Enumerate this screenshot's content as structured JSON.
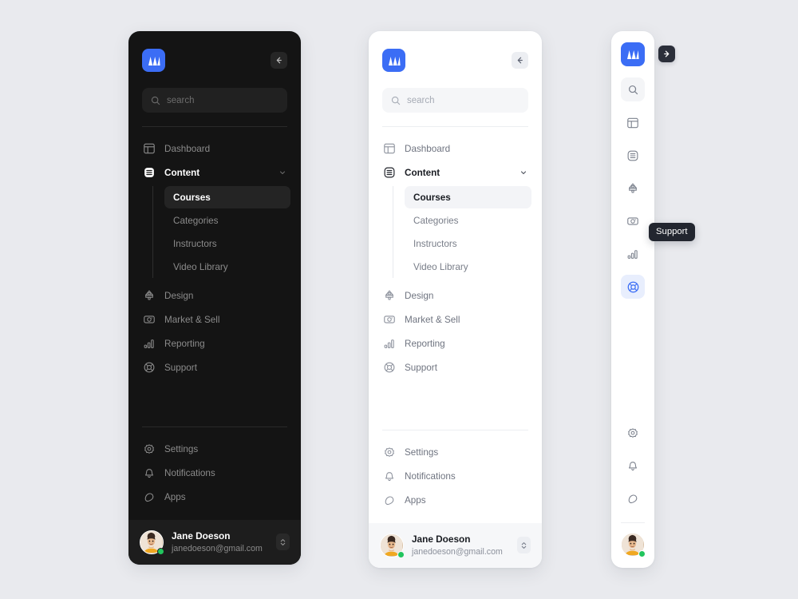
{
  "brand": {
    "logo_icon": "mountain-logo-icon",
    "logo_color": "#3b6df5"
  },
  "search": {
    "placeholder": "search",
    "icon": "search-icon"
  },
  "buttons": {
    "collapse_icon": "arrow-left-icon",
    "expand_icon": "arrow-right-icon",
    "swap_icon": "chevron-up-down-icon"
  },
  "nav": {
    "primary": [
      {
        "label": "Dashboard",
        "icon": "layout-grid-icon",
        "active": false
      },
      {
        "label": "Content",
        "icon": "content-layers-icon",
        "active": true,
        "expandable": true,
        "chevron": "chevron-down-icon"
      },
      {
        "label": "Design",
        "icon": "ink-drop-icon",
        "active": false
      },
      {
        "label": "Market & Sell",
        "icon": "camera-tag-icon",
        "active": false
      },
      {
        "label": "Reporting",
        "icon": "bar-chart-icon",
        "active": false
      },
      {
        "label": "Support",
        "icon": "lifebuoy-icon",
        "active": false
      }
    ],
    "submenu": [
      {
        "label": "Courses",
        "active": true
      },
      {
        "label": "Categories",
        "active": false
      },
      {
        "label": "Instructors",
        "active": false
      },
      {
        "label": "Video Library",
        "active": false
      }
    ],
    "secondary": [
      {
        "label": "Settings",
        "icon": "gear-icon"
      },
      {
        "label": "Notifications",
        "icon": "bell-icon"
      },
      {
        "label": "Apps",
        "icon": "apps-icon"
      }
    ]
  },
  "profile": {
    "name": "Jane Doeson",
    "email": "janedoeson@gmail.com",
    "status": "online",
    "status_color": "#22c55e",
    "avatar": "user-avatar"
  },
  "tooltip": {
    "label": "Support"
  },
  "theme": {
    "page_background": "#e9eaee",
    "dark_panel": "#141414",
    "light_panel": "#ffffff",
    "accent": "#3b6df5",
    "rail_selected": "#e8eefd"
  }
}
